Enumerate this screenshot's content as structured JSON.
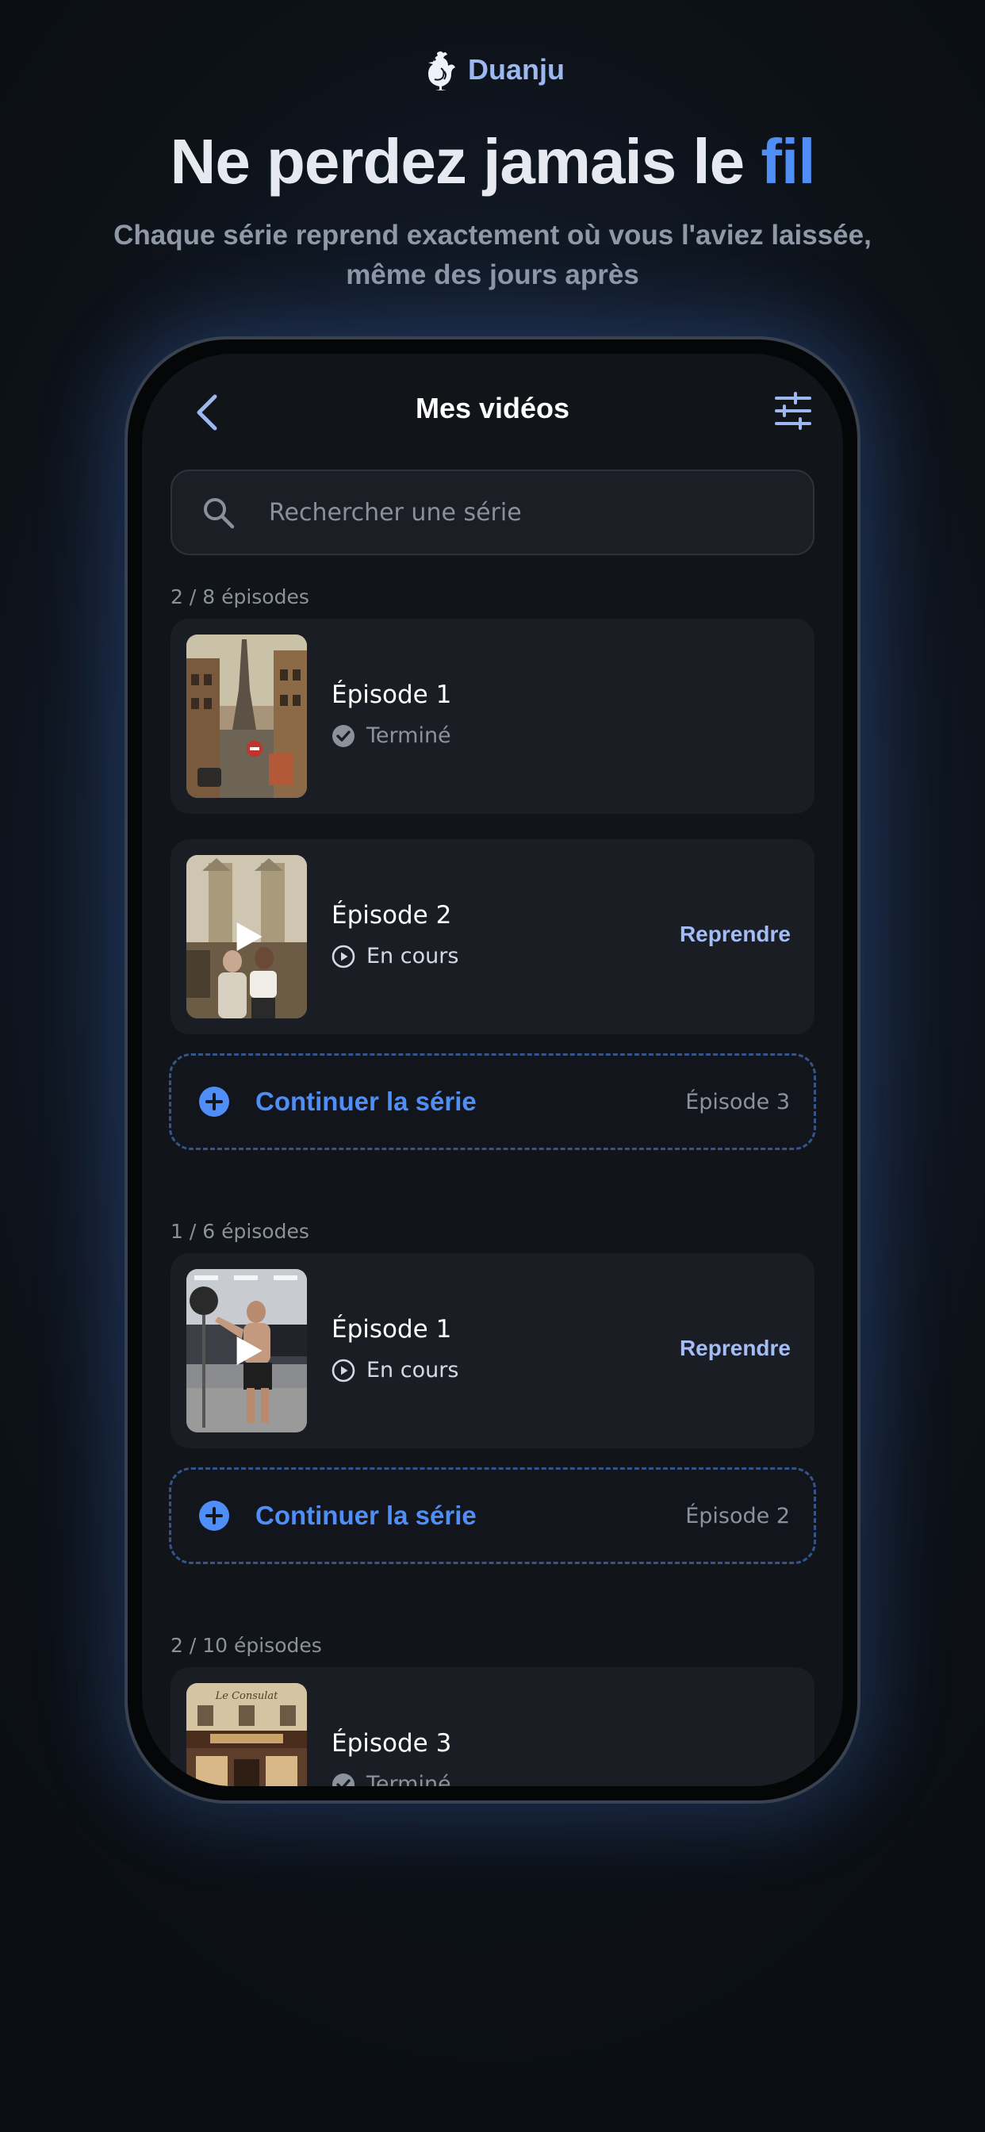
{
  "brand": {
    "name": "Duanju",
    "logo_icon": "rooster-icon"
  },
  "hero": {
    "title_main": "Ne perdez jamais le ",
    "title_accent": "fil",
    "subtitle_line1": "Chaque série reprend exactement où vous l'aviez laissée,",
    "subtitle_line2": "même des jours après"
  },
  "app": {
    "title": "Mes vidéos",
    "search": {
      "placeholder": "Rechercher une série",
      "value": ""
    },
    "groups": [
      {
        "progress_label": "2 / 8 épisodes",
        "episodes": [
          {
            "title": "Épisode 1",
            "status": "Terminé",
            "status_icon": "check-circle-icon",
            "thumb": "paris-street"
          },
          {
            "title": "Épisode 2",
            "status": "En cours",
            "status_icon": "play-circle-icon",
            "action": "Reprendre",
            "thumb": "notre-dame"
          }
        ],
        "continue": {
          "label": "Continuer la série",
          "next_episode": "Épisode 3"
        }
      },
      {
        "progress_label": "1 / 6 épisodes",
        "episodes": [
          {
            "title": "Épisode 1",
            "status": "En cours",
            "status_icon": "play-circle-icon",
            "action": "Reprendre",
            "thumb": "gym"
          }
        ],
        "continue": {
          "label": "Continuer la série",
          "next_episode": "Épisode 2"
        }
      },
      {
        "progress_label": "2 / 10 épisodes",
        "episodes": [
          {
            "title": "Épisode 3",
            "status": "Terminé",
            "status_icon": "check-circle-icon",
            "thumb": "cafe-facade",
            "sign_text": "Le Consulat"
          }
        ]
      }
    ]
  },
  "colors": {
    "accent": "#4f8ef7",
    "accent_soft": "#a4bdf6",
    "card_bg": "#1a1e24",
    "screen_bg": "#111418"
  }
}
